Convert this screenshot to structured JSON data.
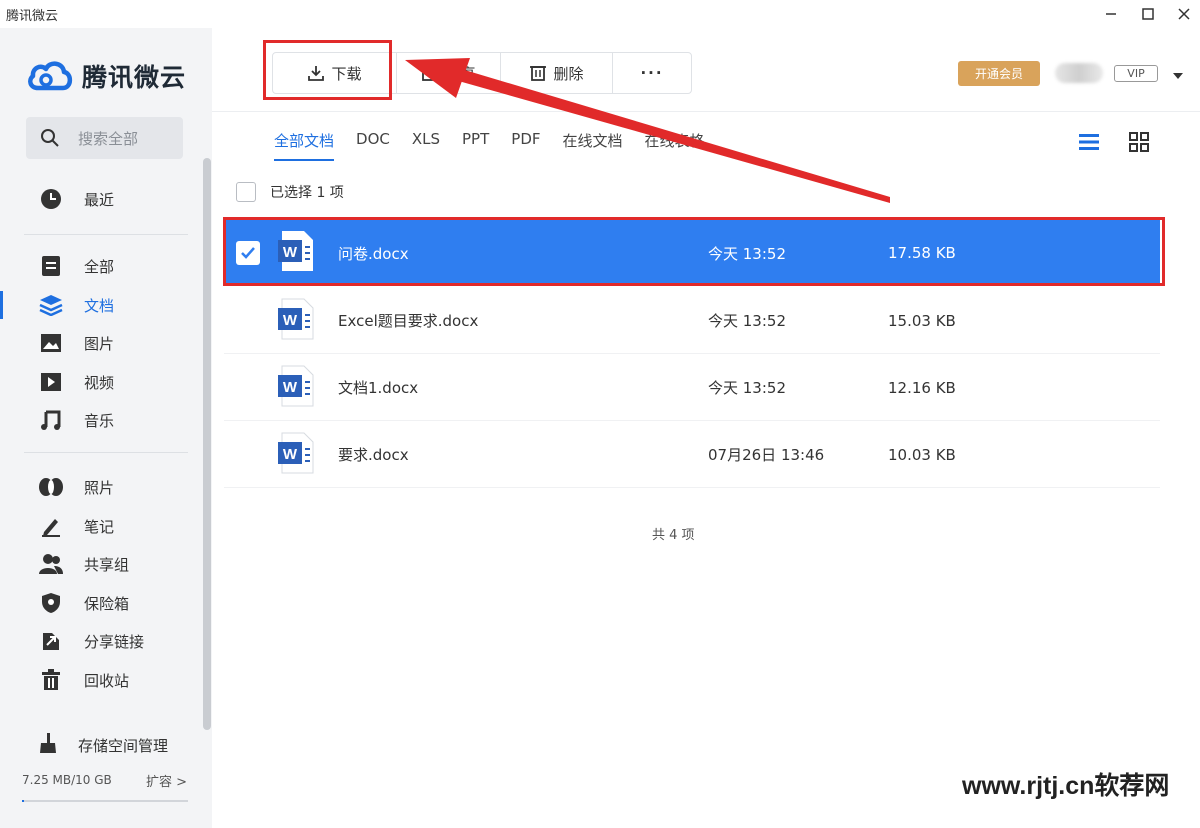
{
  "window": {
    "title": "腾讯微云",
    "minimize_icon": "minimize-icon",
    "maximize_icon": "maximize-icon",
    "close_icon": "close-icon"
  },
  "sidebar": {
    "logo_text": "腾讯微云",
    "search_placeholder": "搜索全部",
    "items": [
      {
        "label": "最近",
        "icon": "clock-icon"
      },
      {
        "label": "全部",
        "icon": "all-files-icon"
      },
      {
        "label": "文档",
        "icon": "layers-icon",
        "active": true
      },
      {
        "label": "图片",
        "icon": "image-icon"
      },
      {
        "label": "视频",
        "icon": "video-icon"
      },
      {
        "label": "音乐",
        "icon": "music-icon"
      },
      {
        "label": "照片",
        "icon": "photo-icon"
      },
      {
        "label": "笔记",
        "icon": "pen-icon"
      },
      {
        "label": "共享组",
        "icon": "group-icon"
      },
      {
        "label": "保险箱",
        "icon": "shield-icon"
      },
      {
        "label": "分享链接",
        "icon": "share-link-icon"
      },
      {
        "label": "回收站",
        "icon": "trash-icon"
      }
    ],
    "storage_manage": "存储空间管理",
    "storage_used": "7.25 MB/10 GB",
    "storage_fraction": 0.0007,
    "expand_label": "扩容 >"
  },
  "toolbar": {
    "download_label": "下载",
    "share_label": "分享",
    "delete_label": "删除",
    "more_label": "···",
    "open_vip_label": "开通会员",
    "vip_badge": "VIP"
  },
  "tabs": [
    "全部文档",
    "DOC",
    "XLS",
    "PPT",
    "PDF",
    "在线文档",
    "在线表格"
  ],
  "selection": {
    "label": "已选择 1 项"
  },
  "files": [
    {
      "name": "问卷.docx",
      "time": "今天 13:52",
      "size": "17.58 KB",
      "selected": true
    },
    {
      "name": "Excel题目要求.docx",
      "time": "今天 13:52",
      "size": "15.03 KB",
      "selected": false
    },
    {
      "name": "文档1.docx",
      "time": "今天 13:52",
      "size": "12.16 KB",
      "selected": false
    },
    {
      "name": "要求.docx",
      "time": "07月26日 13:46",
      "size": "10.03 KB",
      "selected": false
    }
  ],
  "footer": {
    "count": "共 4 项"
  },
  "watermark": "www.rjtj.cn软荐网",
  "colors": {
    "accent": "#1e6fe0",
    "selected_row": "#2f7ef0",
    "annotation_red": "#e12a2a",
    "vip_gold": "#d9a35b"
  }
}
